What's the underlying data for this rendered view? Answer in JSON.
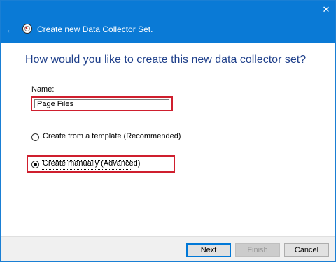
{
  "titlebar": {
    "title": "Create new Data Collector Set.",
    "back_icon": "←",
    "close_icon": "✕"
  },
  "main": {
    "question": "How would you like to create this new data collector set?",
    "name_label": "Name:",
    "name_value": "Page Files",
    "options": [
      {
        "label": "Create from a template (Recommended)",
        "selected": false
      },
      {
        "label": "Create manually (Advanced)",
        "selected": true
      }
    ]
  },
  "footer": {
    "next_label": "Next",
    "finish_label": "Finish",
    "cancel_label": "Cancel"
  },
  "colors": {
    "titlebar": "#0a7ad6",
    "heading": "#1e3f8a",
    "highlight": "#cf1f2e"
  }
}
